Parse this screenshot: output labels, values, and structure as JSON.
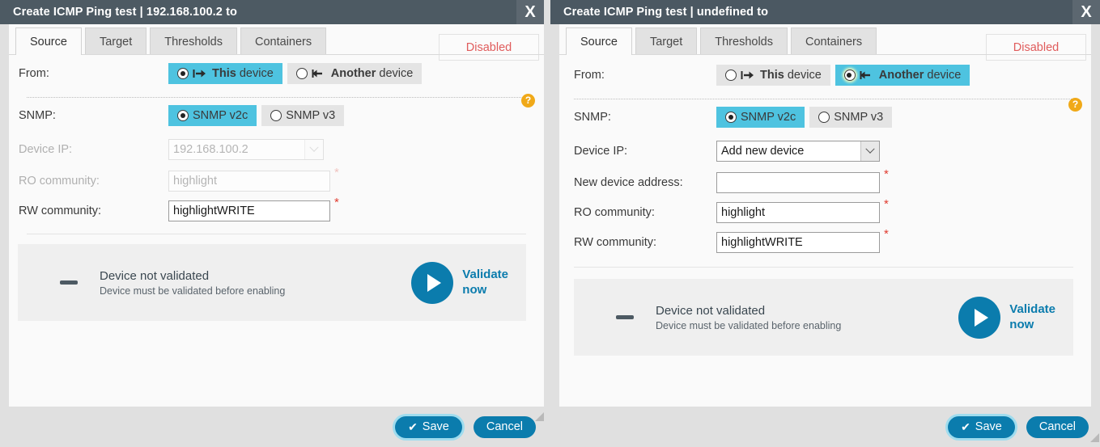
{
  "left": {
    "title": "Create ICMP Ping test | 192.168.100.2 to",
    "close_label": "X",
    "tabs": [
      {
        "label": "Source",
        "active": true
      },
      {
        "label": "Target",
        "active": false
      },
      {
        "label": "Thresholds",
        "active": false
      },
      {
        "label": "Containers",
        "active": false
      }
    ],
    "status_badge": "Disabled",
    "help_icon": "?",
    "from": {
      "label": "From:",
      "this_device": {
        "label_bold": "This",
        "label_rest": " device",
        "icon": "arrow-right-to-bar-icon",
        "selected": true
      },
      "another_device": {
        "label_bold": "Another",
        "label_rest": " device",
        "icon": "arrow-left-from-bar-icon",
        "selected": false
      }
    },
    "snmp": {
      "label": "SNMP:",
      "v2c": {
        "label": "SNMP v2c",
        "selected": true
      },
      "v3": {
        "label": "SNMP v3",
        "selected": false
      }
    },
    "device_ip": {
      "label": "Device IP:",
      "value": "192.168.100.2",
      "disabled": true
    },
    "ro_community": {
      "label": "RO community:",
      "value": "highlight",
      "disabled": true,
      "required": "*"
    },
    "rw_community": {
      "label": "RW community:",
      "value": "highlightWRITE",
      "disabled": false,
      "required": "*"
    },
    "validate": {
      "title": "Device not validated",
      "subtitle": "Device must be validated before enabling",
      "action_line1": "Validate",
      "action_line2": "now",
      "play_icon": "play-icon",
      "status_icon": "dash-icon"
    },
    "buttons": {
      "save": "Save",
      "save_icon": "✔",
      "cancel": "Cancel"
    }
  },
  "right": {
    "title": "Create ICMP Ping test | undefined to",
    "close_label": "X",
    "tabs": [
      {
        "label": "Source",
        "active": true
      },
      {
        "label": "Target",
        "active": false
      },
      {
        "label": "Thresholds",
        "active": false
      },
      {
        "label": "Containers",
        "active": false
      }
    ],
    "status_badge": "Disabled",
    "help_icon": "?",
    "from": {
      "label": "From:",
      "this_device": {
        "label_bold": "This",
        "label_rest": " device",
        "icon": "arrow-right-to-bar-icon",
        "selected": false
      },
      "another_device": {
        "label_bold": "Another",
        "label_rest": " device",
        "icon": "arrow-left-from-bar-icon",
        "selected": true
      }
    },
    "snmp": {
      "label": "SNMP:",
      "v2c": {
        "label": "SNMP v2c",
        "selected": true
      },
      "v3": {
        "label": "SNMP v3",
        "selected": false
      }
    },
    "device_ip": {
      "label": "Device IP:",
      "value": "Add new device",
      "disabled": false
    },
    "new_device_address": {
      "label": "New device address:",
      "value": "",
      "disabled": false,
      "required": "*"
    },
    "ro_community": {
      "label": "RO community:",
      "value": "highlight",
      "disabled": false,
      "required": "*"
    },
    "rw_community": {
      "label": "RW community:",
      "value": "highlightWRITE",
      "disabled": false,
      "required": "*"
    },
    "validate": {
      "title": "Device not validated",
      "subtitle": "Device must be validated before enabling",
      "action_line1": "Validate",
      "action_line2": "now",
      "play_icon": "play-icon",
      "status_icon": "dash-icon"
    },
    "buttons": {
      "save": "Save",
      "save_icon": "✔",
      "cancel": "Cancel"
    }
  },
  "colors": {
    "titlebar": "#4d5a63",
    "accent_cyan": "#4ec3e0",
    "accent_blue": "#0b7cad",
    "required_red": "#e03b2f",
    "disabled_red": "#e05c5c",
    "help_orange": "#f0a918"
  }
}
